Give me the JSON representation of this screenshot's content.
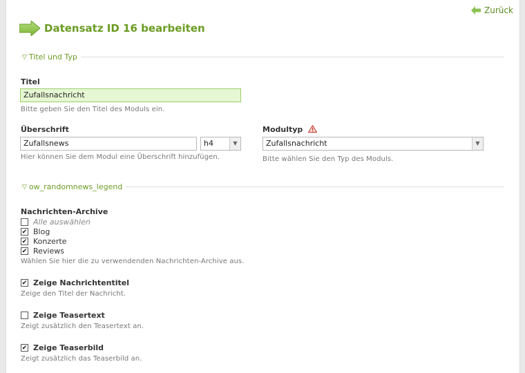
{
  "nav": {
    "back_label": "Zurück"
  },
  "header": {
    "title": "Datensatz ID 16 bearbeiten"
  },
  "section1": {
    "legend": "Titel und Typ"
  },
  "titel": {
    "label": "Titel",
    "value": "Zufallsnachricht",
    "help": "Bitte geben Sie den Titel des Moduls ein."
  },
  "ueberschrift": {
    "label": "Überschrift",
    "value": "Zufallsnews",
    "level": "h4",
    "help": "Hier können Sie dem Modul eine Überschrift hinzufügen."
  },
  "modultyp": {
    "label": "Modultyp",
    "value": "Zufallsnachricht",
    "help": "Bitte wählen Sie den Typ des Moduls."
  },
  "section2": {
    "legend": "ow_randomnews_legend"
  },
  "archive": {
    "label": "Nachrichten-Archive",
    "select_all": "Alle auswählen",
    "items": [
      {
        "label": "Blog",
        "checked": true
      },
      {
        "label": "Konzerte",
        "checked": true
      },
      {
        "label": "Reviews",
        "checked": true
      }
    ],
    "help": "Wählen Sie hier die zu verwendenden Nachrichten-Archive aus."
  },
  "options": [
    {
      "label": "Zeige Nachrichtentitel",
      "checked": true,
      "help": "Zeige den Titel der Nachricht."
    },
    {
      "label": "Zeige Teasertext",
      "checked": false,
      "help": "Zeigt zusätzlich den Teasertext an."
    },
    {
      "label": "Zeige Teaserbild",
      "checked": true,
      "help": "Zeigt zusätzlich das Teaserbild an."
    }
  ]
}
